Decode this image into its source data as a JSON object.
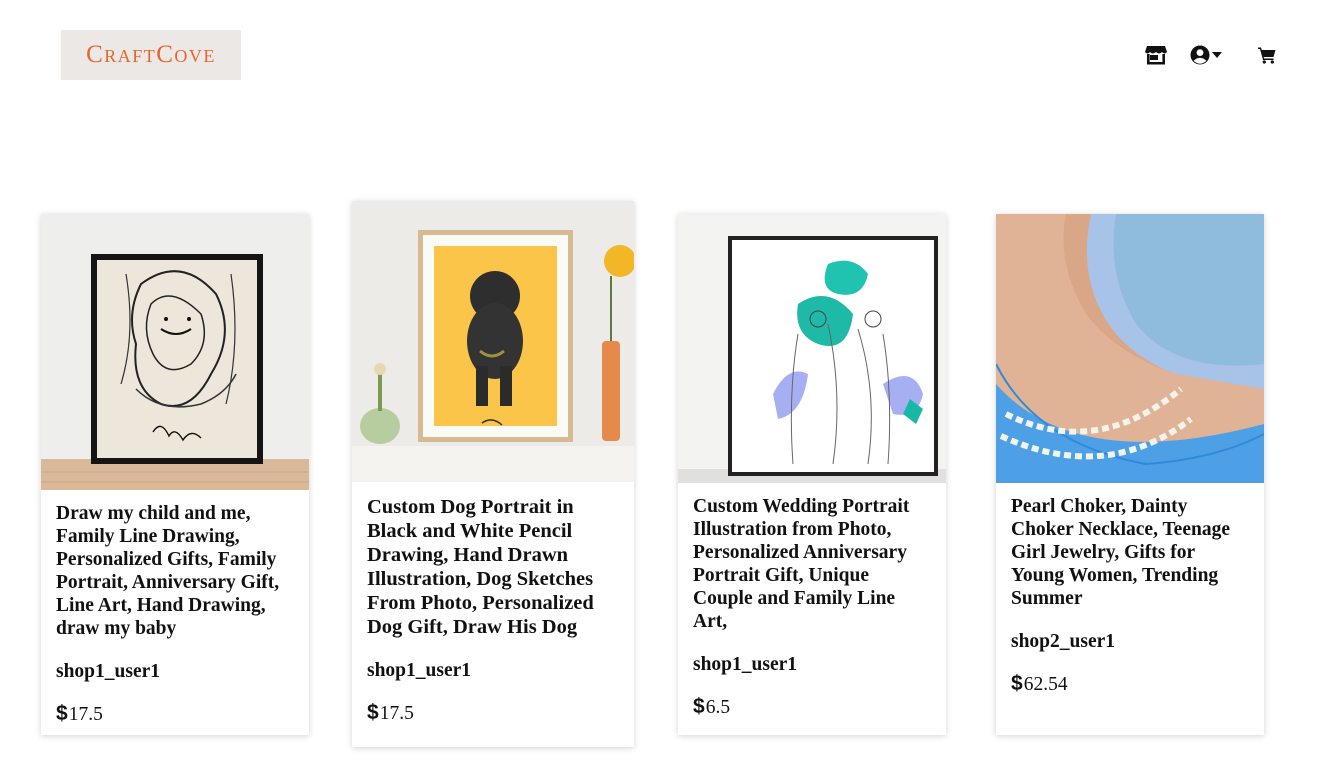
{
  "brand": {
    "logo_text": "CraftCove"
  },
  "nav": {
    "icons": [
      "store-icon",
      "user-circle-icon",
      "caret-down-icon",
      "shopping-cart-icon"
    ]
  },
  "products": [
    {
      "title": "Draw my child and me, Family Line Drawing, Personalized Gifts, Family Portrait, Anniversary Gift, Line Art, Hand Drawing, draw my baby",
      "shop": "shop1_user1",
      "currency": "$",
      "price": "17.5",
      "image": "framed-line-drawing-mother-child"
    },
    {
      "title": "Custom Dog Portrait in Black and White Pencil Drawing, Hand Drawn Illustration, Dog Sketches From Photo, Personalized Dog Gift, Draw His Dog",
      "shop": "shop1_user1",
      "currency": "$",
      "price": "17.5",
      "image": "framed-dog-portrait-yellow"
    },
    {
      "title": "Custom Wedding Portrait Illustration from Photo, Personalized Anniversary Portrait Gift, Unique Couple and Family Line Art,",
      "shop": "shop1_user1",
      "currency": "$",
      "price": "6.5",
      "image": "framed-wedding-line-art"
    },
    {
      "title": "Pearl Choker, Dainty Choker Necklace, Teenage Girl Jewelry, Gifts for Young Women, Trending Summer",
      "shop": "shop2_user1",
      "currency": "$",
      "price": "62.54",
      "image": "pearl-choker-on-neck"
    }
  ]
}
